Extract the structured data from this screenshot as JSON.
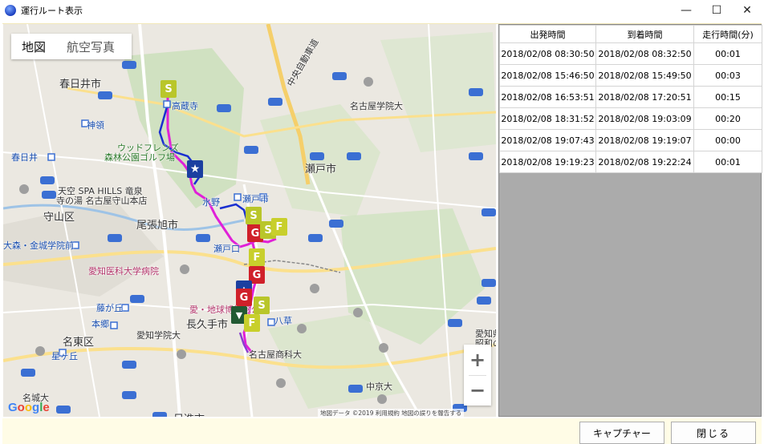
{
  "window": {
    "title": "運行ルート表示",
    "minimize": "—",
    "maximize": "☐",
    "close": "✕"
  },
  "map": {
    "type_buttons": [
      "地図",
      "航空写真"
    ],
    "zoom_in": "+",
    "zoom_out": "−",
    "logo": "Google",
    "attribution": "地図データ ©2019   利用規約   地図の誤りを報告する",
    "labels": [
      {
        "text": "春日井市",
        "size": "big"
      },
      {
        "text": "高蔵寺",
        "size": "normal"
      },
      {
        "text": "神領",
        "size": "normal"
      },
      {
        "text": "ウッドフレンズ",
        "size": "normal"
      },
      {
        "text": "森林公園ゴルフ場",
        "size": "normal"
      },
      {
        "text": "春日井",
        "size": "normal"
      },
      {
        "text": "天空 SPA HILLS 竜泉",
        "size": "normal"
      },
      {
        "text": "寺の湯 名古屋守山本店",
        "size": "normal"
      },
      {
        "text": "守山区",
        "size": "big"
      },
      {
        "text": "尾張旭市",
        "size": "big"
      },
      {
        "text": "瀬戸市",
        "size": "big"
      },
      {
        "text": "名古屋学院大",
        "size": "normal"
      },
      {
        "text": "中央自動車道",
        "size": "normal"
      },
      {
        "text": "水野",
        "size": "normal"
      },
      {
        "text": "瀬戸市",
        "size": "normal"
      },
      {
        "text": "瀬戸口",
        "size": "normal"
      },
      {
        "text": "大森・金城学院前",
        "size": "normal"
      },
      {
        "text": "愛知医科大学病院",
        "size": "normal"
      },
      {
        "text": "藤が丘",
        "size": "normal"
      },
      {
        "text": "本郷",
        "size": "normal"
      },
      {
        "text": "愛知学院大",
        "size": "normal"
      },
      {
        "text": "愛・地球博記念公園",
        "size": "normal"
      },
      {
        "text": "長久手市",
        "size": "big"
      },
      {
        "text": "八草",
        "size": "normal"
      },
      {
        "text": "名古屋商科大",
        "size": "normal"
      },
      {
        "text": "名東区",
        "size": "big"
      },
      {
        "text": "星ヶ丘",
        "size": "normal"
      },
      {
        "text": "中京大",
        "size": "normal"
      },
      {
        "text": "日進市",
        "size": "big"
      },
      {
        "text": "名城大",
        "size": "normal"
      },
      {
        "text": "愛知県立大",
        "size": "normal"
      },
      {
        "text": "昭和の",
        "size": "normal"
      }
    ],
    "markers": [
      "S",
      "S",
      "G",
      "S",
      "F",
      "F",
      "G",
      "G",
      "S",
      "F"
    ]
  },
  "table": {
    "headers": [
      "出発時間",
      "到着時間",
      "走行時間(分)"
    ],
    "rows": [
      [
        "2018/02/08 08:30:50",
        "2018/02/08 08:32:50",
        "00:01"
      ],
      [
        "2018/02/08 15:46:50",
        "2018/02/08 15:49:50",
        "00:03"
      ],
      [
        "2018/02/08 16:53:51",
        "2018/02/08 17:20:51",
        "00:15"
      ],
      [
        "2018/02/08 18:31:52",
        "2018/02/08 19:03:09",
        "00:20"
      ],
      [
        "2018/02/08 19:07:43",
        "2018/02/08 19:19:07",
        "00:00"
      ],
      [
        "2018/02/08 19:19:23",
        "2018/02/08 19:22:24",
        "00:01"
      ]
    ]
  },
  "buttons": {
    "capture": "キャプチャー",
    "close": "閉じる"
  },
  "colors": {
    "route_magenta": "#e020d8",
    "route_blue": "#1a2fd0",
    "route_purple": "#8a3fd0"
  }
}
